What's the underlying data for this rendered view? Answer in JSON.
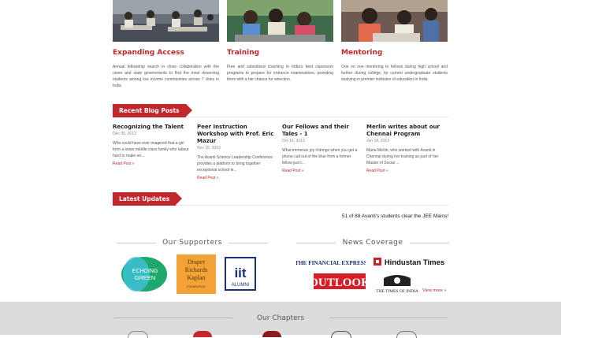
{
  "features": [
    {
      "title": "Expanding Access",
      "text": "Annual fellowship search in close collaboration with the union and state governments to find the most deserving students among low income communities across 7 cities in India"
    },
    {
      "title": "Training",
      "text": "Free and subsidized coaching in India's best classroom programs to prepare for entrance examinations, providing them with a fair chance for selection."
    },
    {
      "title": "Mentoring",
      "text": "One on one mentoring to fellows during high school and further during college, by current undergraduate students studying in premier institutes of education in India"
    }
  ],
  "blog": {
    "heading": "Recent Blog Posts",
    "posts": [
      {
        "title": "Recognizing the Talent",
        "date": "Dec 05, 2013",
        "excerpt": "Who could have ever imagined that a girl form a lowar middle class family who labour hard to make en...",
        "read": "Read Post »"
      },
      {
        "title": "Peer Instruction Workshop with Prof. Eric Mazur",
        "date": "Nov 16, 2013",
        "excerpt": "The Avanti Science Leadership Conference provides a platform to bring together exceptional school le...",
        "read": "Read Post »"
      },
      {
        "title": "Our Fellows and their Tales - 1",
        "date": "Oct 16, 2013",
        "excerpt": "What immense joy it brings when you get a phone call out of the blue from a former fellow just t...",
        "read": "Read Post »"
      },
      {
        "title": "Merlin writes about our Chennai Program",
        "date": "Jun 18, 2013",
        "excerpt": "Maria Merlin, who worked with Avanti in Chennai during her training as part of her Master of Social ...",
        "read": "Read Post »"
      }
    ]
  },
  "updates": {
    "heading": "Latest Updates",
    "text": "51 of 88 Avanti's students clear the JEE Mains!"
  },
  "supporters": {
    "heading": "Our Supporters",
    "logos": {
      "echoing": [
        "ECHOING",
        "GREEN"
      ],
      "draper": [
        "Draper",
        "Richards",
        "Kaplan",
        "FOUNDATION"
      ],
      "iit": [
        "iit",
        "ALUMNI"
      ]
    }
  },
  "news": {
    "heading": "News Coverage",
    "logos": {
      "fe": "THE FINANCIAL EXPRESS",
      "ht": "Hindustan Times",
      "outlook": "OUTLOOK",
      "toi": "THE TIMES OF INDIA"
    },
    "more": "View more »"
  },
  "chapters": {
    "heading": "Our Chapters"
  },
  "colors": {
    "accent": "#c0282d",
    "band": "#dcdcdc"
  }
}
